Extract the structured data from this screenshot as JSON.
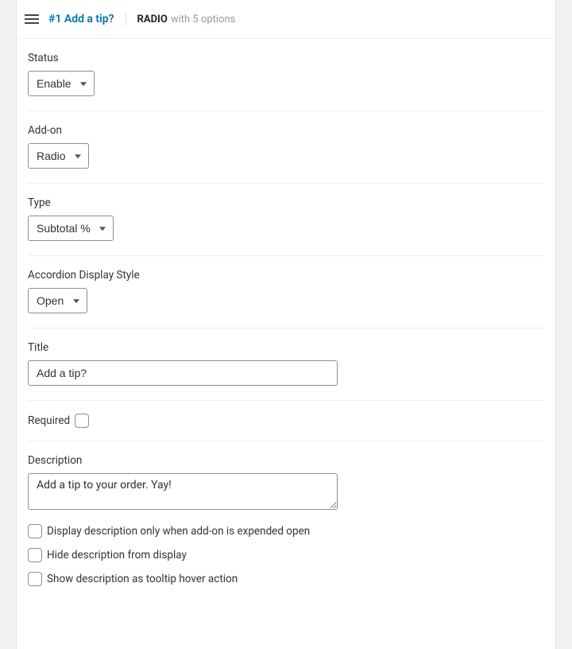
{
  "header": {
    "title": "#1 Add a tip?",
    "type": "RADIO",
    "suffix": "with 5 options"
  },
  "fields": {
    "status": {
      "label": "Status",
      "value": "Enable"
    },
    "addon": {
      "label": "Add-on",
      "value": "Radio"
    },
    "type": {
      "label": "Type",
      "value": "Subtotal %"
    },
    "accordion": {
      "label": "Accordion Display Style",
      "value": "Open"
    },
    "title": {
      "label": "Title",
      "value": "Add a tip?"
    },
    "required": {
      "label": "Required"
    },
    "description": {
      "label": "Description",
      "value": "Add a tip to your order. Yay!"
    },
    "opts": {
      "displayOnlyExpanded": "Display description only when add-on is expended open",
      "hideFromDisplay": "Hide description from display",
      "showAsTooltip": "Show description as tooltip hover action"
    }
  }
}
